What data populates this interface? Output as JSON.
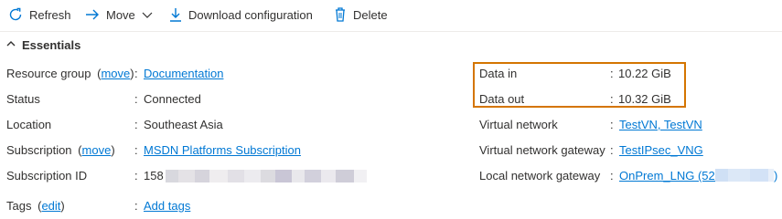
{
  "toolbar": {
    "refresh_label": "Refresh",
    "move_label": "Move",
    "download_label": "Download configuration",
    "delete_label": "Delete"
  },
  "essentials": {
    "header": "Essentials"
  },
  "left": {
    "resource_group_label": "Resource group",
    "move_link": "move",
    "resource_group_value": "Documentation",
    "status_label": "Status",
    "status_value": "Connected",
    "location_label": "Location",
    "location_value": "Southeast Asia",
    "subscription_label": "Subscription",
    "subscription_move_link": "move",
    "subscription_value": "MSDN Platforms Subscription",
    "subscription_id_label": "Subscription ID",
    "subscription_id_value": "158",
    "tags_label": "Tags",
    "edit_link": "edit",
    "tags_value": "Add tags"
  },
  "right": {
    "data_in_label": "Data in",
    "data_in_value": "10.22 GiB",
    "data_out_label": "Data out",
    "data_out_value": "10.32 GiB",
    "vnet_label": "Virtual network",
    "vnet_value": "TestVN, TestVN",
    "vnet_gateway_label": "Virtual network gateway",
    "vnet_gateway_value": "TestIPsec_VNG",
    "local_gateway_label": "Local network gateway",
    "local_gateway_value": "OnPrem_LNG (52."
  },
  "colors": {
    "accent": "#0078d4",
    "highlight_border": "#d47500",
    "text": "#323130"
  },
  "punct": {
    "colon": ":",
    "open_paren": "(",
    "close_paren": ")"
  }
}
